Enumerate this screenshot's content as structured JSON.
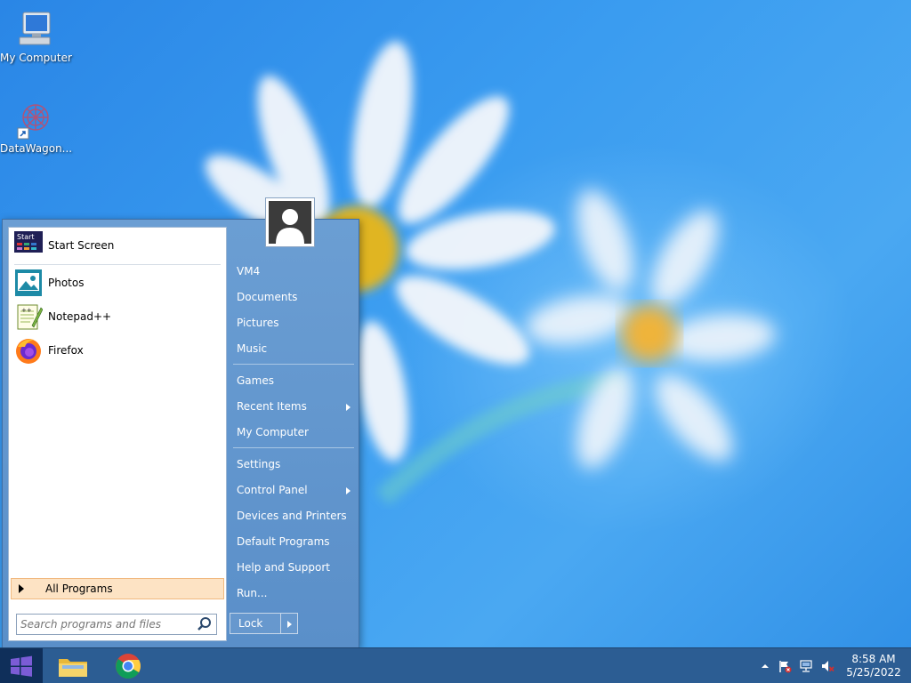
{
  "desktop": {
    "icons": [
      {
        "label": "My Computer",
        "icon": "computer-icon"
      },
      {
        "label": "DataWagon...",
        "icon": "datawagon-icon"
      }
    ]
  },
  "start_menu": {
    "pinned": [
      {
        "label": "Start Screen",
        "icon": "start-screen-icon"
      }
    ],
    "programs": [
      {
        "label": "Photos",
        "icon": "photos-icon"
      },
      {
        "label": "Notepad++",
        "icon": "notepadpp-icon"
      },
      {
        "label": "Firefox",
        "icon": "firefox-icon"
      }
    ],
    "start_screen_badge": "Start",
    "all_programs_label": "All Programs",
    "search_placeholder": "Search programs and files",
    "places": [
      {
        "label": "VM4",
        "submenu": false
      },
      {
        "label": "Documents",
        "submenu": false
      },
      {
        "label": "Pictures",
        "submenu": false
      },
      {
        "label": "Music",
        "submenu": false
      },
      {
        "label": "Games",
        "submenu": false
      },
      {
        "label": "Recent Items",
        "submenu": true
      },
      {
        "label": "My Computer",
        "submenu": false
      },
      {
        "label": "Settings",
        "submenu": false
      },
      {
        "label": "Control Panel",
        "submenu": true
      },
      {
        "label": "Devices and Printers",
        "submenu": false
      },
      {
        "label": "Default Programs",
        "submenu": false
      },
      {
        "label": "Help and Support",
        "submenu": false
      },
      {
        "label": "Run...",
        "submenu": false
      }
    ],
    "lock_label": "Lock"
  },
  "taskbar": {
    "apps": [
      {
        "name": "file-explorer",
        "icon": "folder-icon"
      },
      {
        "name": "chrome",
        "icon": "chrome-icon"
      }
    ],
    "tray": [
      "show-hidden-icons",
      "action-center-flag-icon",
      "network-icon",
      "volume-muted-icon"
    ],
    "clock": {
      "time": "8:58 AM",
      "date": "5/25/2022"
    }
  },
  "colors": {
    "wallpaper": "#3a9cf0",
    "start_menu_right": "#5a8fc9",
    "taskbar": "#2c5d93",
    "highlight": "#fde3c4"
  }
}
